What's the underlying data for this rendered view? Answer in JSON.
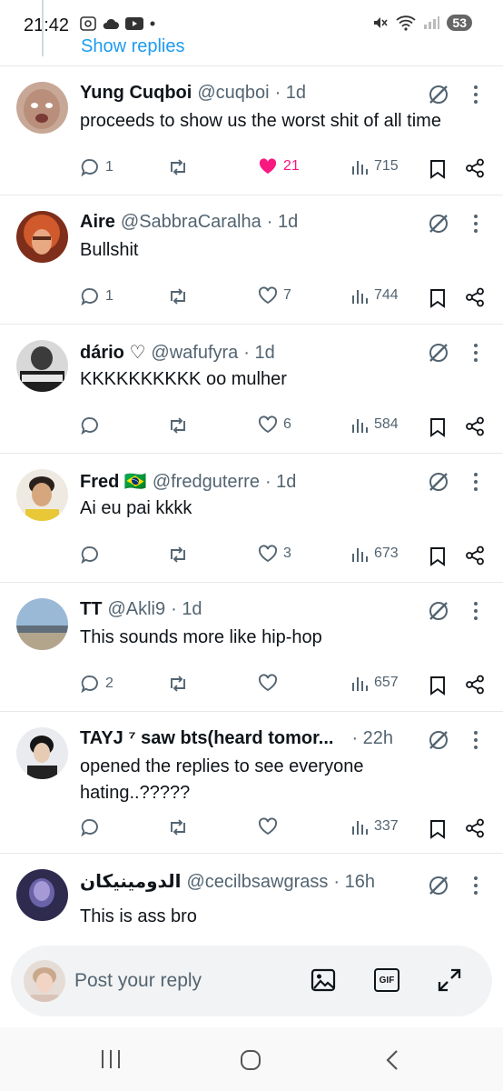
{
  "status_bar": {
    "time": "21:42",
    "battery": "53"
  },
  "thread": {
    "show_replies": "Show replies"
  },
  "tweets": [
    {
      "name": "Yung Cuqboi",
      "handle": "@cuqboi",
      "time": "1d",
      "text": "proceeds to show us the worst shit of all time",
      "replies": "1",
      "reposts": "",
      "likes": "21",
      "liked": true,
      "views": "715",
      "avatar_color": "#b98f7c"
    },
    {
      "name": "Aire",
      "handle": "@SabbraCaralha",
      "time": "1d",
      "text": "Bullshit",
      "replies": "1",
      "reposts": "",
      "likes": "7",
      "liked": false,
      "views": "744",
      "avatar_color": "#c9552a"
    },
    {
      "name": "dário ♡",
      "handle": "@wafufyra",
      "time": "1d",
      "text": "KKKKKKKKKK oo mulher",
      "replies": "",
      "reposts": "",
      "likes": "6",
      "liked": false,
      "views": "584",
      "avatar_color": "#3b3b3b"
    },
    {
      "name": "Fred 🇧🇷",
      "handle": "@fredguterre",
      "time": "1d",
      "text": "Ai eu pai kkkk",
      "replies": "",
      "reposts": "",
      "likes": "3",
      "liked": false,
      "views": "673",
      "avatar_color": "#c4a26c"
    },
    {
      "name": "TT",
      "handle": "@Akli9",
      "time": "1d",
      "text": "This sounds more like hip-hop",
      "replies": "2",
      "reposts": "",
      "likes": "",
      "liked": false,
      "views": "657",
      "avatar_color": "#8aa6c2"
    },
    {
      "name": "TAYJ ⁷ saw bts(heard tomor...",
      "handle": "",
      "time": "22h",
      "text": "opened the replies to see everyone hating..?????",
      "replies": "",
      "reposts": "",
      "likes": "",
      "liked": false,
      "views": "337",
      "avatar_color": "#2b2b2b"
    },
    {
      "name": "الدومينيكان",
      "handle": "@cecilbsawgrass",
      "time": "16h",
      "text": "This is ass bro",
      "replies": "",
      "reposts": "",
      "likes": "",
      "liked": false,
      "views": "",
      "avatar_color": "#3a3760"
    }
  ],
  "reply_bar": {
    "placeholder": "Post your reply",
    "gif_label": "GIF"
  },
  "colors": {
    "accent": "#1d9bf0",
    "like": "#f91880",
    "muted": "#536471"
  }
}
